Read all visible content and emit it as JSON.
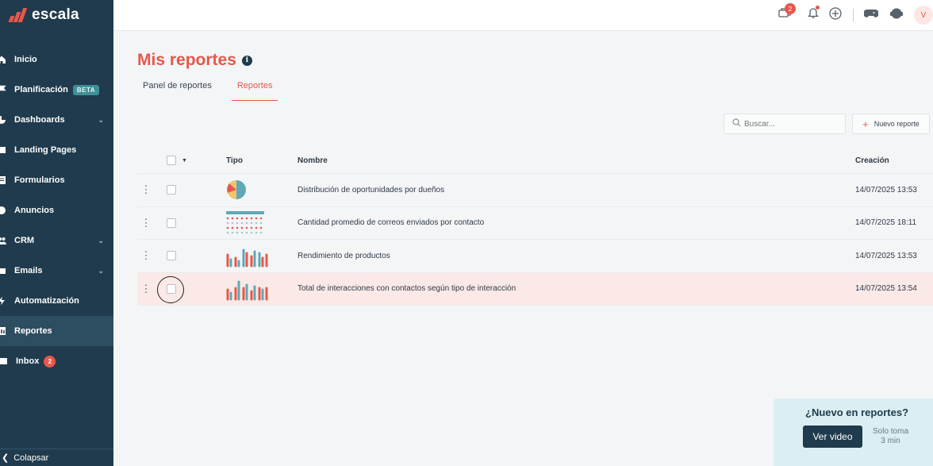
{
  "brand": {
    "name": "escala",
    "accent": "#e8574a",
    "sidebar_bg": "#1f3b4d"
  },
  "sidebar": {
    "items": [
      {
        "label": "Inicio",
        "icon": "home-icon"
      },
      {
        "label": "Planificación",
        "icon": "flag-icon",
        "badge": "BETA"
      },
      {
        "label": "Dashboards",
        "icon": "chart-icon",
        "expandable": true
      },
      {
        "label": "Landing Pages",
        "icon": "page-icon"
      },
      {
        "label": "Formularios",
        "icon": "form-icon"
      },
      {
        "label": "Anuncios",
        "icon": "megaphone-icon"
      },
      {
        "label": "CRM",
        "icon": "users-icon",
        "expandable": true
      },
      {
        "label": "Emails",
        "icon": "mail-icon",
        "expandable": true
      },
      {
        "label": "Automatización",
        "icon": "bolt-icon"
      },
      {
        "label": "Reportes",
        "icon": "report-icon",
        "active": true
      },
      {
        "label": "Inbox",
        "icon": "inbox-icon",
        "count": "2"
      }
    ],
    "collapse_label": "Colapsar"
  },
  "topbar": {
    "chat_count": "2",
    "avatar_initial": "V",
    "icons": [
      "chat-icon",
      "bell-icon",
      "add-circle-icon",
      "gamepad-icon",
      "support-icon"
    ]
  },
  "page": {
    "title": "Mis reportes",
    "tabs": [
      {
        "label": "Panel de reportes",
        "active": false
      },
      {
        "label": "Reportes",
        "active": true
      }
    ],
    "search_placeholder": "Buscar...",
    "new_button_label": "Nuevo reporte"
  },
  "table": {
    "headers": {
      "type": "Tipo",
      "name": "Nombre",
      "created": "Creación"
    },
    "rows": [
      {
        "type": "pie",
        "name": "Distribución de oportunidades por dueños",
        "created": "14/07/2025 13:53"
      },
      {
        "type": "table",
        "name": "Cantidad promedio de correos enviados por contacto",
        "created": "14/07/2025 18:11"
      },
      {
        "type": "bar",
        "name": "Rendimiento de productos",
        "created": "14/07/2025 13:53"
      },
      {
        "type": "bar",
        "name": "Total de interacciones con contactos según tipo de interacción",
        "created": "14/07/2025 13:54",
        "hover": true
      }
    ]
  },
  "promo": {
    "title": "¿Nuevo en reportes?",
    "button_label": "Ver video",
    "note_line1": "Solo toma",
    "note_line2": "3 min"
  }
}
